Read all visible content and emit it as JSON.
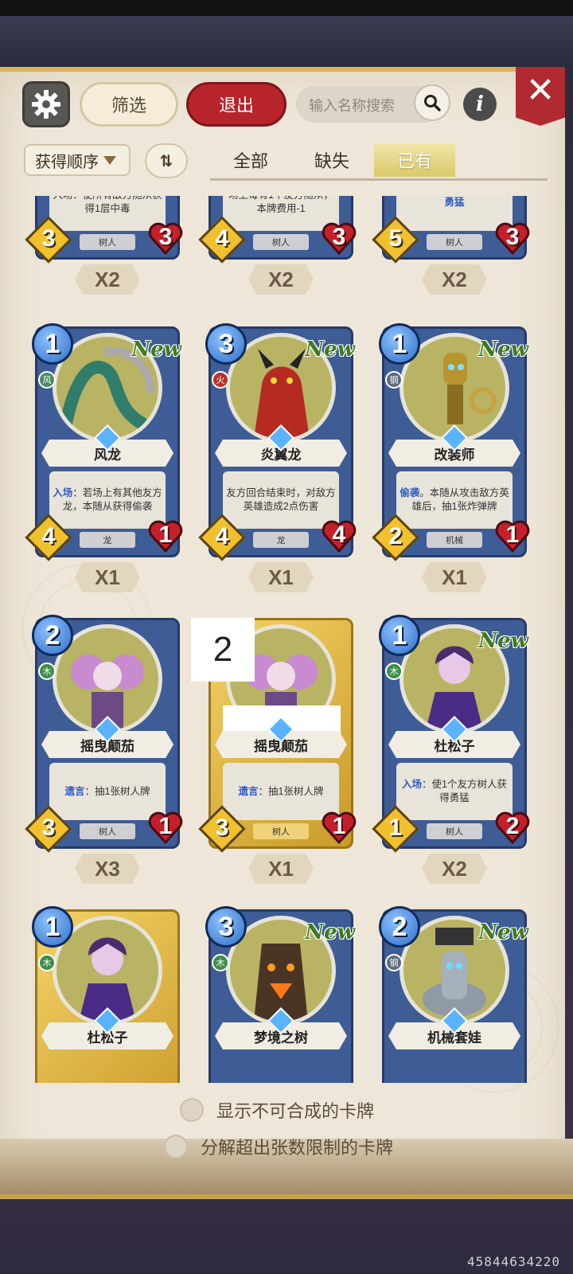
{
  "top_bar": {
    "filter_label": "筛选",
    "exit_label": "退出",
    "search_placeholder": "输入名称搜索",
    "info_label": "i",
    "close_label": "✕"
  },
  "sort": {
    "label": "获得顺序",
    "toggle_label": "⇅"
  },
  "tabs": [
    {
      "label": "全部",
      "active": false
    },
    {
      "label": "缺失",
      "active": false
    },
    {
      "label": "已有",
      "active": true
    }
  ],
  "cards_partial_top": [
    {
      "desc": "入场：使所有敌方随从获得1层中毒",
      "tribe": "树人",
      "attack": "3",
      "health": "3",
      "count": "X2"
    },
    {
      "desc": "场上每有1个友方随从，本牌费用-1",
      "tribe": "树人",
      "attack": "4",
      "health": "3",
      "count": "X2"
    },
    {
      "desc": "勇猛",
      "tribe": "树人",
      "attack": "5",
      "health": "3",
      "count": "X2"
    }
  ],
  "cards": [
    {
      "name": "风龙",
      "cost": "1",
      "element": "风",
      "new": "New",
      "desc_prefix": "入场",
      "desc": "：若场上有其他友方龙，本随从获得偷袭",
      "tribe": "龙",
      "attack": "4",
      "health": "1",
      "count": "X1"
    },
    {
      "name": "炎翼龙",
      "cost": "3",
      "element": "火",
      "new": "New",
      "desc_prefix": "",
      "desc": "友方回合结束时，对敌方英雄造成2点伤害",
      "tribe": "龙",
      "attack": "4",
      "health": "4",
      "count": "X1"
    },
    {
      "name": "改装师",
      "cost": "1",
      "element": "钢",
      "new": "New",
      "desc_prefix": "偷袭",
      "desc": "。本随从攻击敌方英雄后，抽1张炸弹牌",
      "tribe": "机械",
      "attack": "2",
      "health": "1",
      "count": "X1"
    },
    {
      "name": "摇曳颠茄",
      "cost": "2",
      "element": "木",
      "new": "",
      "desc_prefix": "遗言",
      "desc": "：抽1张树人牌",
      "tribe": "树人",
      "attack": "3",
      "health": "1",
      "count": "X3"
    },
    {
      "name": "摇曳颠茄",
      "cost": "2",
      "element": "木",
      "new": "",
      "desc_prefix": "遗言",
      "desc": "：抽1张树人牌",
      "tribe": "树人",
      "attack": "3",
      "health": "1",
      "count": "X1"
    },
    {
      "name": "杜松子",
      "cost": "1",
      "element": "木",
      "new": "New",
      "desc_prefix": "入场",
      "desc": "：使1个友方树人获得勇猛",
      "tribe": "树人",
      "attack": "1",
      "health": "2",
      "count": "X2"
    },
    {
      "name": "杜松子",
      "cost": "1",
      "element": "木",
      "new": "",
      "desc_prefix": "",
      "desc": "",
      "tribe": "",
      "attack": "",
      "health": "",
      "count": ""
    },
    {
      "name": "梦境之树",
      "cost": "3",
      "element": "木",
      "new": "New",
      "desc_prefix": "",
      "desc": "",
      "tribe": "",
      "attack": "",
      "health": "",
      "count": ""
    },
    {
      "name": "机械套娃",
      "cost": "2",
      "element": "钢",
      "new": "New",
      "desc_prefix": "",
      "desc": "",
      "tribe": "",
      "attack": "",
      "health": "",
      "count": ""
    }
  ],
  "overlay_number": "2",
  "options": {
    "show_uncraftable": "显示不可合成的卡牌",
    "disenchant_excess": "分解超出张数限制的卡牌"
  },
  "footer_id": "45844634220",
  "colors": {
    "exit": "#b8242b",
    "tab_active": "#d9c96a",
    "card_blue": "#3e5c96",
    "card_gold": "#e0b440"
  }
}
